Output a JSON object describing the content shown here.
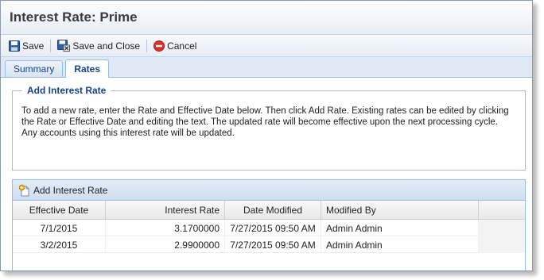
{
  "window": {
    "title": "Interest Rate: Prime"
  },
  "toolbar": {
    "save_label": "Save",
    "save_close_label": "Save and Close",
    "cancel_label": "Cancel"
  },
  "tabs": [
    {
      "label": "Summary",
      "active": false
    },
    {
      "label": "Rates",
      "active": true
    }
  ],
  "add_rate_panel": {
    "legend": "Add Interest Rate",
    "instructions": "To add a new rate, enter the Rate and Effective Date below. Then click Add Rate. Existing rates can be edited by clicking the Rate or Effective Date and editing the text. The updated rate will become effective upon the next processing cycle. Any accounts using this interest rate will be updated."
  },
  "grid": {
    "add_button_label": "Add Interest Rate",
    "columns": [
      "Effective Date",
      "Interest Rate",
      "Date Modified",
      "Modified By"
    ],
    "rows": [
      {
        "effective_date": "7/1/2015",
        "interest_rate": "3.1700000",
        "date_modified": "7/27/2015 09:50 AM",
        "modified_by": "Admin Admin"
      },
      {
        "effective_date": "3/2/2015",
        "interest_rate": "2.9900000",
        "date_modified": "7/27/2015 09:50 AM",
        "modified_by": "Admin Admin"
      }
    ]
  },
  "colors": {
    "accent": "#15428b",
    "tab_border": "#99bbe8",
    "cancel_red": "#d9322a"
  }
}
